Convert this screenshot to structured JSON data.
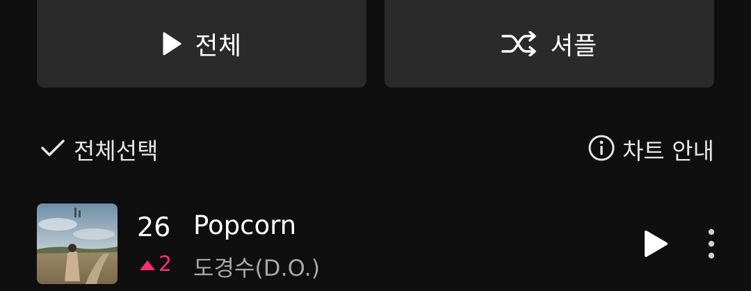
{
  "controls": {
    "play_all_label": "전체",
    "shuffle_label": "셔플",
    "play_icon": "play-icon",
    "shuffle_icon": "shuffle-icon"
  },
  "list_header": {
    "select_all_label": "전체선택",
    "chart_info_label": "차트 안내"
  },
  "track": {
    "rank": "26",
    "rank_change": "2",
    "rank_change_direction": "up",
    "title": "Popcorn",
    "artist": "도경수(D.O.)"
  },
  "colors": {
    "background": "#0f0f0f",
    "button_bg": "#2a2a2a",
    "rank_up": "#ff2d78",
    "secondary_text": "#a8a8a8"
  }
}
